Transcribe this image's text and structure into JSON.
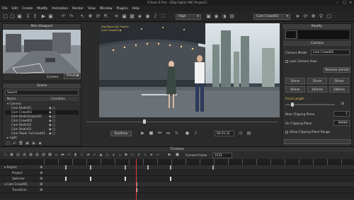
{
  "app": {
    "title": "iClone 6 Pro - [Dig Fights INC-Project]"
  },
  "menu": [
    "File",
    "Edit",
    "Create",
    "Modify",
    "Animation",
    "Render",
    "View",
    "Window",
    "Plugins",
    "Help"
  ],
  "toolbar": {
    "quality": "High",
    "camera": "Cam Crowd01"
  },
  "mini_viewport": {
    "title": "Mini Viewport",
    "camera_label": "Camera",
    "view_mode": "Preview"
  },
  "scene": {
    "title": "Scene",
    "search_placeholder": "Search",
    "col_name": "Name",
    "col_condition": "Condition",
    "items": [
      "Camera",
      "Cam Static01",
      "Cam Crowd01",
      "Cam StaticScopes01",
      "Cam Crowd01",
      "Cam Static02",
      "Cam Static03",
      "Cam Tower FxCrowd01"
    ],
    "light": "Light"
  },
  "viewport": {
    "overlay1": "Dig Fights INC-Project",
    "overlay2": "Cam Crowd01",
    "realtime": "Realtime",
    "timecode": "00:25:32"
  },
  "modify": {
    "title": "Modify",
    "tab_camera": "Camera",
    "camera_name_label": "Camera Model",
    "camera_name": "Cam Crowd01",
    "lock_label": "Lock Camera View",
    "lens_btn": "Remove animat",
    "lens": [
      "20mm",
      "35mm",
      "50mm",
      "60mm",
      "105mm",
      "200mm"
    ],
    "focal_label": "Focal Length",
    "focal_value": "10",
    "near_label": "Near Clipping Plane",
    "near_value": "1",
    "far_label": "Far Clipping Plane",
    "far_value": "99999",
    "show_clip": "Show Clipping Plane Range"
  },
  "timeline": {
    "title": "Timeline",
    "current_frame_label": "Current Frame",
    "current_frame": "1533",
    "rows": [
      "Project",
      "Project",
      "Switcher",
      "Cam Crowd01",
      "Transform"
    ]
  }
}
